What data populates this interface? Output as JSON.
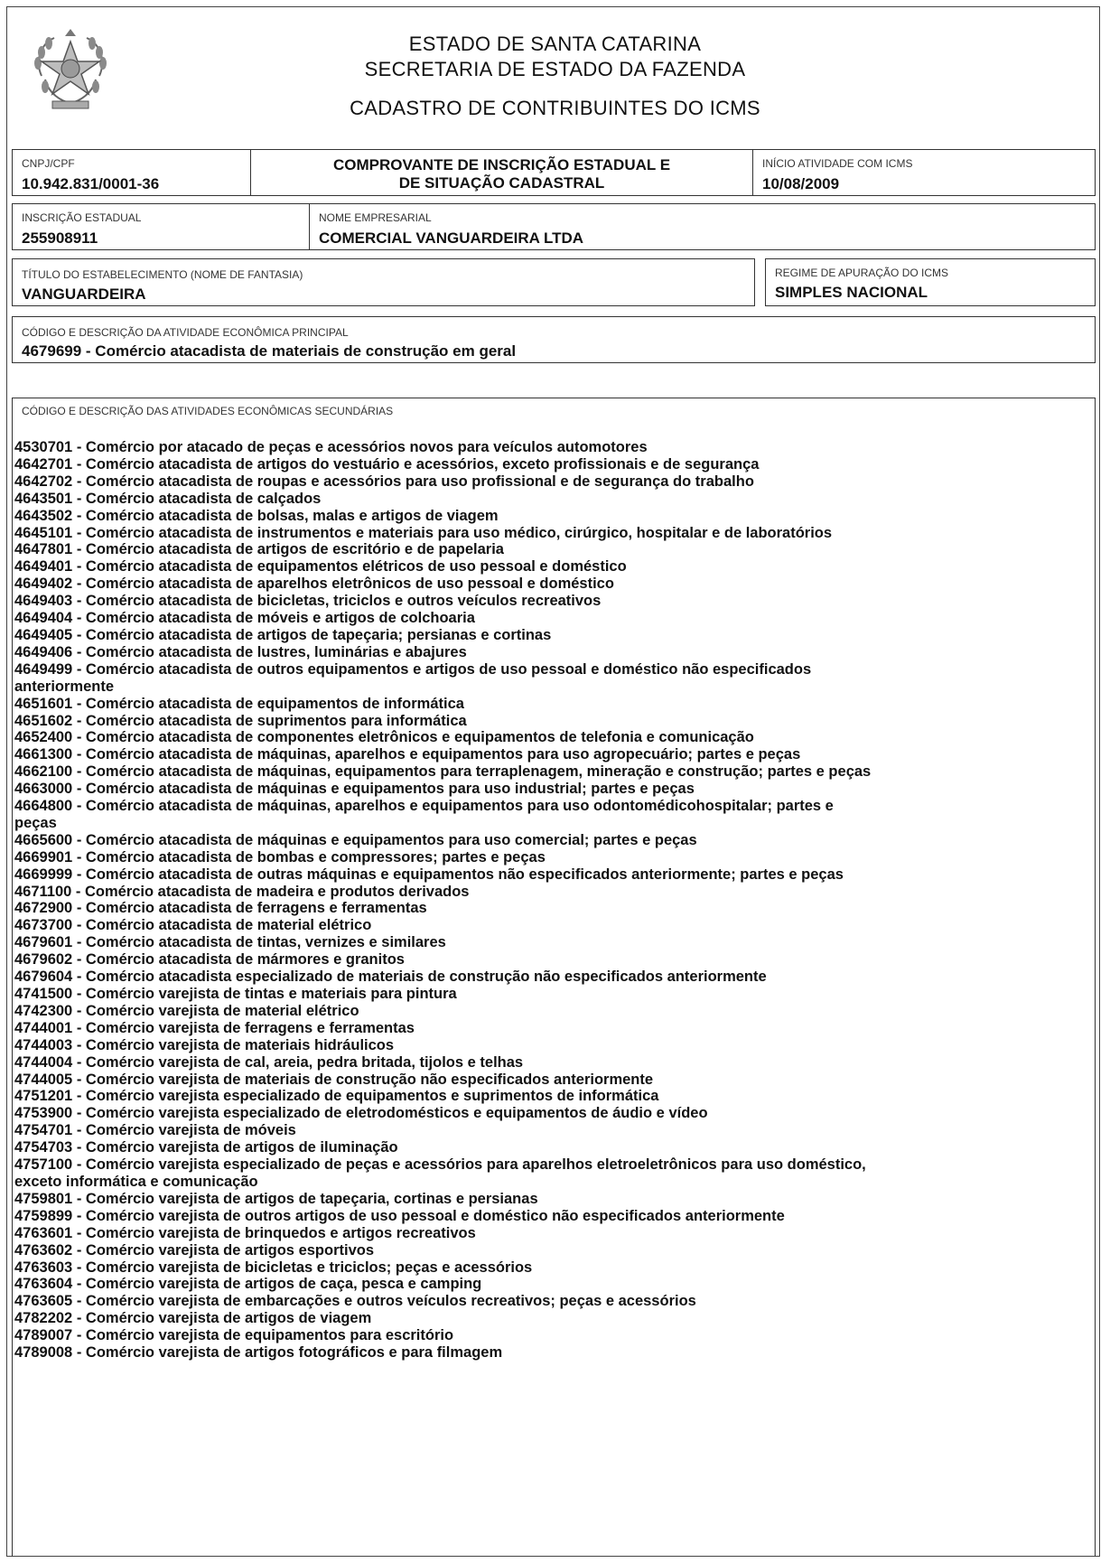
{
  "header": {
    "state": "ESTADO DE SANTA CATARINA",
    "secretariat": "SECRETARIA DE ESTADO DA FAZENDA",
    "registry": "CADASTRO DE CONTRIBUINTES DO ICMS"
  },
  "cnpj": {
    "label": "CNPJ/CPF",
    "value": "10.942.831/0001-36"
  },
  "title": {
    "line1": "COMPROVANTE DE INSCRIÇÃO ESTADUAL E",
    "line2": "DE SITUAÇÃO CADASTRAL"
  },
  "inicio": {
    "label": "INÍCIO ATIVIDADE COM ICMS",
    "value": "10/08/2009"
  },
  "inscricao": {
    "label": "INSCRIÇÃO ESTADUAL",
    "value": "255908911"
  },
  "nome": {
    "label": "NOME EMPRESARIAL",
    "value": "COMERCIAL VANGUARDEIRA LTDA"
  },
  "fantasia": {
    "label": "TÍTULO DO ESTABELECIMENTO (NOME DE FANTASIA)",
    "value": "VANGUARDEIRA"
  },
  "regime": {
    "label": "REGIME DE APURAÇÃO DO ICMS",
    "value": "SIMPLES NACIONAL"
  },
  "principal": {
    "label": "CÓDIGO E DESCRIÇÃO DA ATIVIDADE ECONÔMICA PRINCIPAL",
    "value": "4679699 - Comércio atacadista de materiais de construção em geral"
  },
  "secundarias": {
    "label": "CÓDIGO E DESCRIÇÃO DAS ATIVIDADES ECONÔMICAS SECUNDÁRIAS",
    "lines": [
      "4530701 - Comércio por atacado de peças e acessórios novos para veículos automotores",
      "4642701 - Comércio atacadista de artigos do vestuário e acessórios, exceto profissionais e de segurança",
      "4642702 - Comércio atacadista de roupas e acessórios para uso profissional e de segurança do trabalho",
      "4643501 - Comércio atacadista de calçados",
      "4643502 - Comércio atacadista de bolsas, malas e artigos de viagem",
      "4645101 - Comércio atacadista de instrumentos e materiais para uso médico, cirúrgico, hospitalar e de laboratórios",
      "4647801 - Comércio atacadista de artigos de escritório e de papelaria",
      "4649401 - Comércio atacadista de equipamentos elétricos de uso pessoal e doméstico",
      "4649402 - Comércio atacadista de aparelhos eletrônicos de uso pessoal e doméstico",
      "4649403 - Comércio atacadista de bicicletas, triciclos e outros veículos recreativos",
      "4649404 - Comércio atacadista de móveis e artigos de colchoaria",
      "4649405 - Comércio atacadista de artigos de tapeçaria; persianas e cortinas",
      "4649406 - Comércio atacadista de lustres, luminárias e abajures",
      "4649499 - Comércio atacadista de outros equipamentos e artigos de uso pessoal e doméstico não especificados",
      "anteriormente",
      "4651601 - Comércio atacadista de equipamentos de informática",
      "4651602 - Comércio atacadista de suprimentos para informática",
      "4652400 - Comércio atacadista de componentes eletrônicos e equipamentos de telefonia e comunicação",
      "4661300 - Comércio atacadista de máquinas, aparelhos e equipamentos para uso agropecuário; partes e peças",
      "4662100 - Comércio atacadista de máquinas, equipamentos para terraplenagem, mineração e construção; partes e peças",
      "4663000 - Comércio atacadista de máquinas e equipamentos para uso industrial; partes e peças",
      "4664800 - Comércio atacadista de máquinas, aparelhos e equipamentos para uso odontomédicohospitalar; partes e",
      "peças",
      "4665600 - Comércio atacadista de máquinas e equipamentos para uso comercial; partes e peças",
      "4669901 - Comércio atacadista de bombas e compressores; partes e peças",
      "4669999 - Comércio atacadista de outras máquinas e equipamentos não especificados anteriormente; partes e peças",
      "4671100 - Comércio atacadista de madeira e produtos derivados",
      "4672900 - Comércio atacadista de ferragens e ferramentas",
      "4673700 - Comércio atacadista de material elétrico",
      "4679601 - Comércio atacadista de tintas, vernizes e similares",
      "4679602 - Comércio atacadista de mármores e granitos",
      "4679604 - Comércio atacadista especializado de materiais de construção não especificados anteriormente",
      "4741500 - Comércio varejista de tintas e materiais para pintura",
      "4742300 - Comércio varejista de material elétrico",
      "4744001 - Comércio varejista de ferragens e ferramentas",
      "4744003 - Comércio varejista de materiais hidráulicos",
      "4744004 - Comércio varejista de cal, areia, pedra britada, tijolos e telhas",
      "4744005 - Comércio varejista de materiais de construção não especificados anteriormente",
      "4751201 - Comércio varejista especializado de equipamentos e suprimentos de informática",
      "4753900 - Comércio varejista especializado de eletrodomésticos e equipamentos de áudio e vídeo",
      "4754701 - Comércio varejista de móveis",
      "4754703 - Comércio varejista de artigos de iluminação",
      "4757100 - Comércio varejista especializado de peças e acessórios para aparelhos eletroeletrônicos para uso doméstico,",
      "exceto informática e comunicação",
      "4759801 - Comércio varejista de artigos de tapeçaria, cortinas e persianas",
      "4759899 - Comércio varejista de outros artigos de uso pessoal e doméstico não especificados anteriormente",
      "4763601 - Comércio varejista de brinquedos e artigos recreativos",
      "4763602 - Comércio varejista de artigos esportivos",
      "4763603 - Comércio varejista de bicicletas e triciclos; peças e acessórios",
      "4763604 - Comércio varejista de artigos de caça, pesca e camping",
      "4763605 - Comércio varejista de embarcações e outros veículos recreativos; peças e acessórios",
      "4782202 - Comércio varejista de artigos de viagem",
      "4789007 - Comércio varejista de equipamentos para escritório",
      "4789008 - Comércio varejista de artigos fotográficos e para filmagem"
    ]
  }
}
